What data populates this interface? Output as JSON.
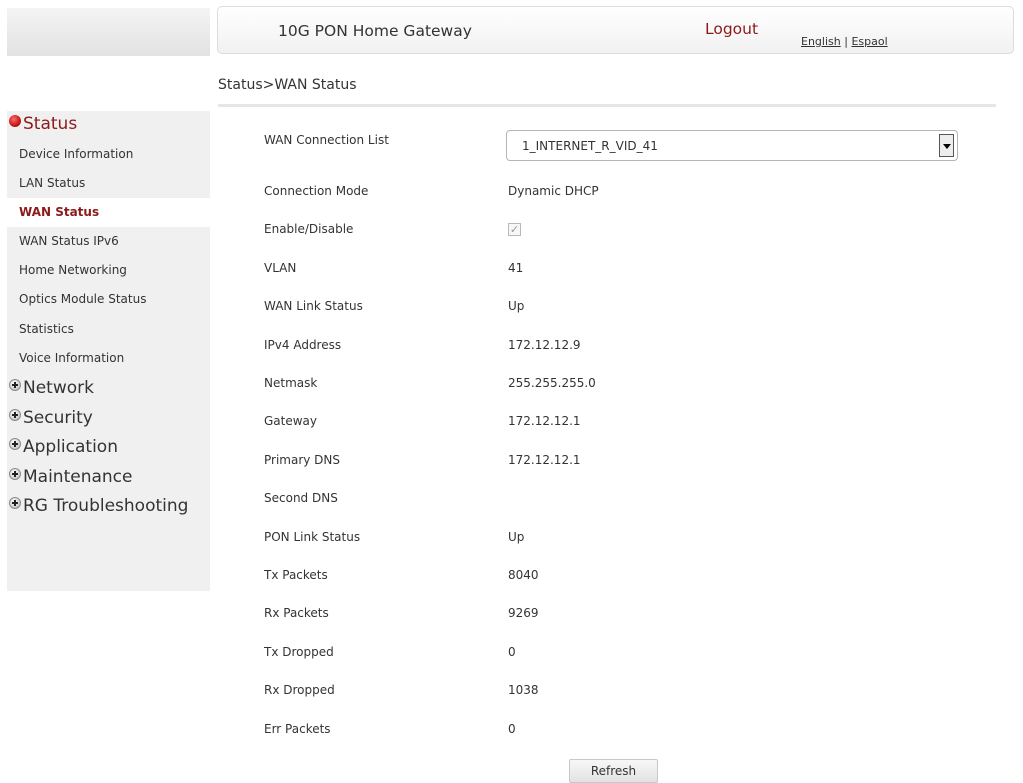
{
  "header": {
    "title": "10G PON Home Gateway",
    "logout": "Logout",
    "lang_english": "English",
    "lang_separator": "|",
    "lang_spanish": "Espaol"
  },
  "breadcrumb": "Status>WAN Status",
  "sidebar": {
    "status": "Status",
    "items": [
      "Device Information",
      "LAN Status",
      "WAN Status",
      "WAN Status IPv6",
      "Home Networking",
      "Optics Module Status",
      "Statistics",
      "Voice Information"
    ],
    "active_item": "WAN Status",
    "network": "Network",
    "security": "Security",
    "application": "Application",
    "maintenance": "Maintenance",
    "rg_troubleshooting": "RG Troubleshooting"
  },
  "form": {
    "wan_connection_list_label": "WAN Connection List",
    "wan_connection_list_value": "1_INTERNET_R_VID_41",
    "enable_disable_label": "Enable/Disable",
    "enable_disable_checked": true,
    "fields": [
      {
        "label": "Connection Mode",
        "value": "Dynamic DHCP"
      },
      {
        "label": "VLAN",
        "value": "41"
      },
      {
        "label": "WAN Link Status",
        "value": "Up"
      },
      {
        "label": "IPv4 Address",
        "value": "172.12.12.9"
      },
      {
        "label": "Netmask",
        "value": "255.255.255.0"
      },
      {
        "label": "Gateway",
        "value": "172.12.12.1"
      },
      {
        "label": "Primary DNS",
        "value": "172.12.12.1"
      },
      {
        "label": "Second DNS",
        "value": ""
      },
      {
        "label": "PON Link Status",
        "value": "Up"
      },
      {
        "label": "Tx Packets",
        "value": "8040"
      },
      {
        "label": "Rx Packets",
        "value": "9269"
      },
      {
        "label": "Tx Dropped",
        "value": "0"
      },
      {
        "label": "Rx Dropped",
        "value": "1038"
      },
      {
        "label": "Err Packets",
        "value": "0"
      }
    ]
  },
  "buttons": {
    "refresh": "Refresh"
  },
  "colors": {
    "accent": "#8c1a1a",
    "sidebar_bg": "#f0f0f0"
  }
}
